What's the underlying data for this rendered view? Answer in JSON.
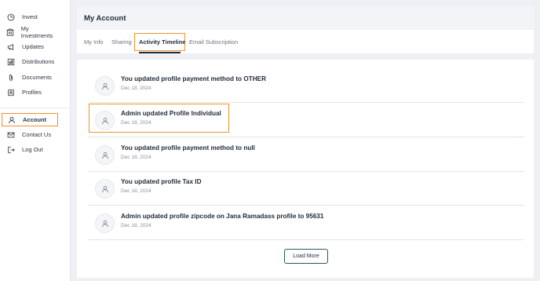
{
  "sidebar": {
    "items": [
      {
        "label": "Invest",
        "icon": "invest-icon"
      },
      {
        "label": "My Investments",
        "icon": "building-icon"
      },
      {
        "label": "Updates",
        "icon": "megaphone-icon"
      },
      {
        "label": "Distributions",
        "icon": "distributions-icon"
      },
      {
        "label": "Documents",
        "icon": "paperclip-icon"
      },
      {
        "label": "Profiles",
        "icon": "profiles-icon"
      },
      {
        "label": "Account",
        "icon": "user-icon",
        "active": true
      },
      {
        "label": "Contact Us",
        "icon": "mail-icon"
      },
      {
        "label": "Log Out",
        "icon": "logout-icon"
      }
    ]
  },
  "header": {
    "title": "My Account",
    "tabs": [
      {
        "label": "My Info"
      },
      {
        "label": "Sharing"
      },
      {
        "label": "Activity Timeline",
        "active": true
      },
      {
        "label": "Email Subscription"
      }
    ]
  },
  "timeline": {
    "items": [
      {
        "title": "You updated profile payment method to OTHER",
        "date": "Dec 18, 2024"
      },
      {
        "title": "Admin updated Profile Individual",
        "date": "Dec 18, 2024"
      },
      {
        "title": "You updated profile payment method to null",
        "date": "Dec 18, 2024"
      },
      {
        "title": "You updated profile Tax ID",
        "date": "Dec 18, 2024"
      },
      {
        "title": "Admin updated profile zipcode on Jana Ramadass profile to 95631",
        "date": "Dec 18, 2024"
      }
    ],
    "load_more_label": "Load More"
  },
  "colors": {
    "highlight": "#f0932b",
    "accent": "#2a5560"
  }
}
